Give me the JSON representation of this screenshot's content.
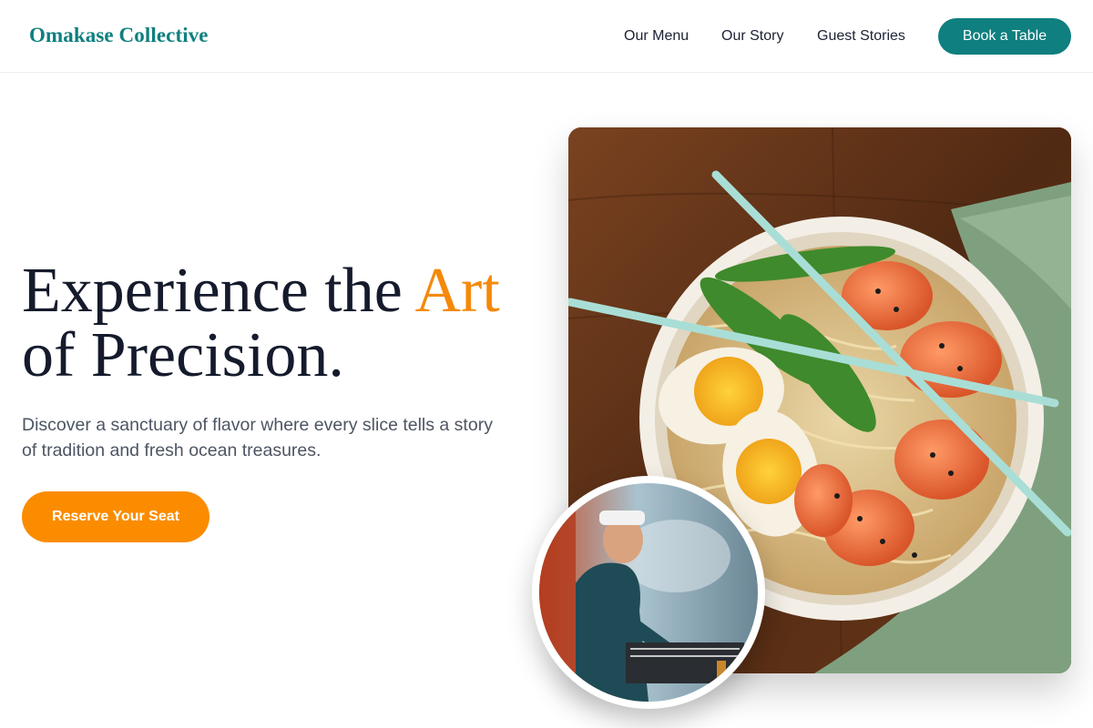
{
  "header": {
    "brand": "Omakase Collective",
    "nav": [
      "Our Menu",
      "Our Story",
      "Guest Stories"
    ],
    "cta": "Book a Table"
  },
  "hero": {
    "headline_before": "Experience the ",
    "headline_accent": "Art",
    "headline_after": "of Precision.",
    "subtext": "Discover a sanctuary of flavor where every slice tells a story of tradition and fresh ocean treasures.",
    "cta": "Reserve Your Seat"
  },
  "colors": {
    "brand_teal": "#0f7f7f",
    "accent_orange": "#f5890a",
    "button_orange": "#fb8c00"
  },
  "images": {
    "main": "ramen-bowl-photo",
    "inset": "chef-grilling-photo"
  }
}
